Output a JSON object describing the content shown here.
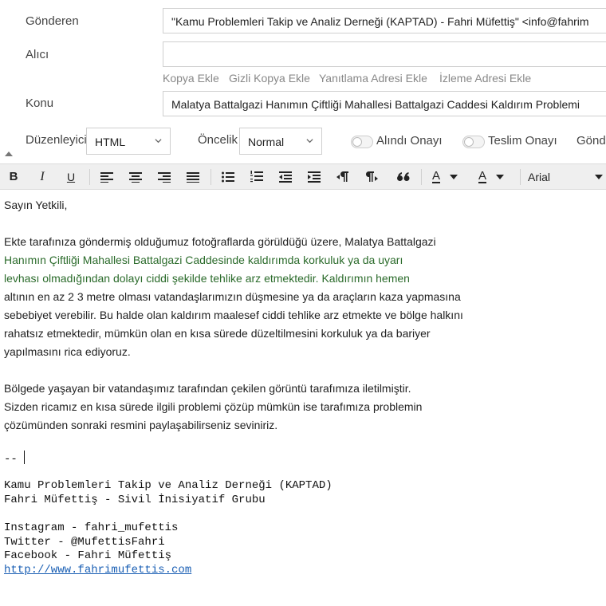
{
  "header": {
    "from_label": "Gönderen",
    "from_value": "\"Kamu Problemleri Takip ve Analiz Derneği (KAPTAD) - Fahri Müfettiş\" <info@fahrim",
    "to_label": "Alıcı",
    "to_value": "",
    "add_links": [
      "Kopya Ekle",
      "Gizli Kopya Ekle",
      "Yanıtlama Adresi Ekle",
      "İzleme Adresi Ekle"
    ],
    "subject_label": "Konu",
    "subject_value": "Malatya Battalgazi Hanımın Çiftliği Mahallesi Battalgazi Caddesi Kaldırım Problemi"
  },
  "options": {
    "editor_label": "Düzenleyici",
    "editor_value": "HTML",
    "priority_label": "Öncelik",
    "priority_value": "Normal",
    "read_receipt_label": "Alındı Onayı",
    "delivery_receipt_label": "Teslim Onayı",
    "send_label": "Gönd"
  },
  "toolbar": {
    "bold": "B",
    "italic": "I",
    "underline": "U",
    "font_color_letter": "A",
    "bg_color_letter": "A",
    "font_name": "Arial"
  },
  "message": {
    "greeting": "Sayın Yetkili,",
    "p1_lines": [
      "Ekte tarafınıza göndermiş olduğumuz fotoğraflarda görüldüğü üzere, Malatya Battalgazi",
      "Hanımın Çiftliği Mahallesi Battalgazi Caddesinde kaldırımda korkuluk ya da uyarı",
      "levhası olmadığından dolayı ciddi şekilde tehlike arz etmektedir. Kaldırımın hemen",
      "altının en az 2 3 metre olması vatandaşlarımızın düşmesine ya da araçların kaza yapmasına",
      "sebebiyet verebilir. Bu halde olan kaldırım maalesef ciddi tehlike arz etmekte ve bölge halkını",
      "rahatsız etmektedir, mümkün olan en kısa sürede düzeltilmesini korkuluk ya da bariyer",
      "yapılmasını rica ediyoruz."
    ],
    "p2_lines": [
      "Bölgede yaşayan bir vatandaşımız tarafından çekilen görüntü tarafımıza iletilmiştir.",
      "Sizden ricamız en kısa sürede ilgili problemi çözüp mümkün ise tarafımıza problemin",
      "çözümünden sonraki resmini paylaşabilirseniz seviniriz."
    ],
    "sig_separator": "-- ",
    "sig_org": "Kamu Problemleri Takip ve Analiz Derneği (KAPTAD)",
    "sig_group": "Fahri Müfettiş - Sivil İnisiyatif Grubu",
    "sig_instagram": "Instagram - fahri_mufettis",
    "sig_twitter": "Twitter - @MufettisFahri",
    "sig_facebook": "Facebook - Fahri Müfettiş",
    "sig_url": "http://www.fahrimufettis.com"
  }
}
